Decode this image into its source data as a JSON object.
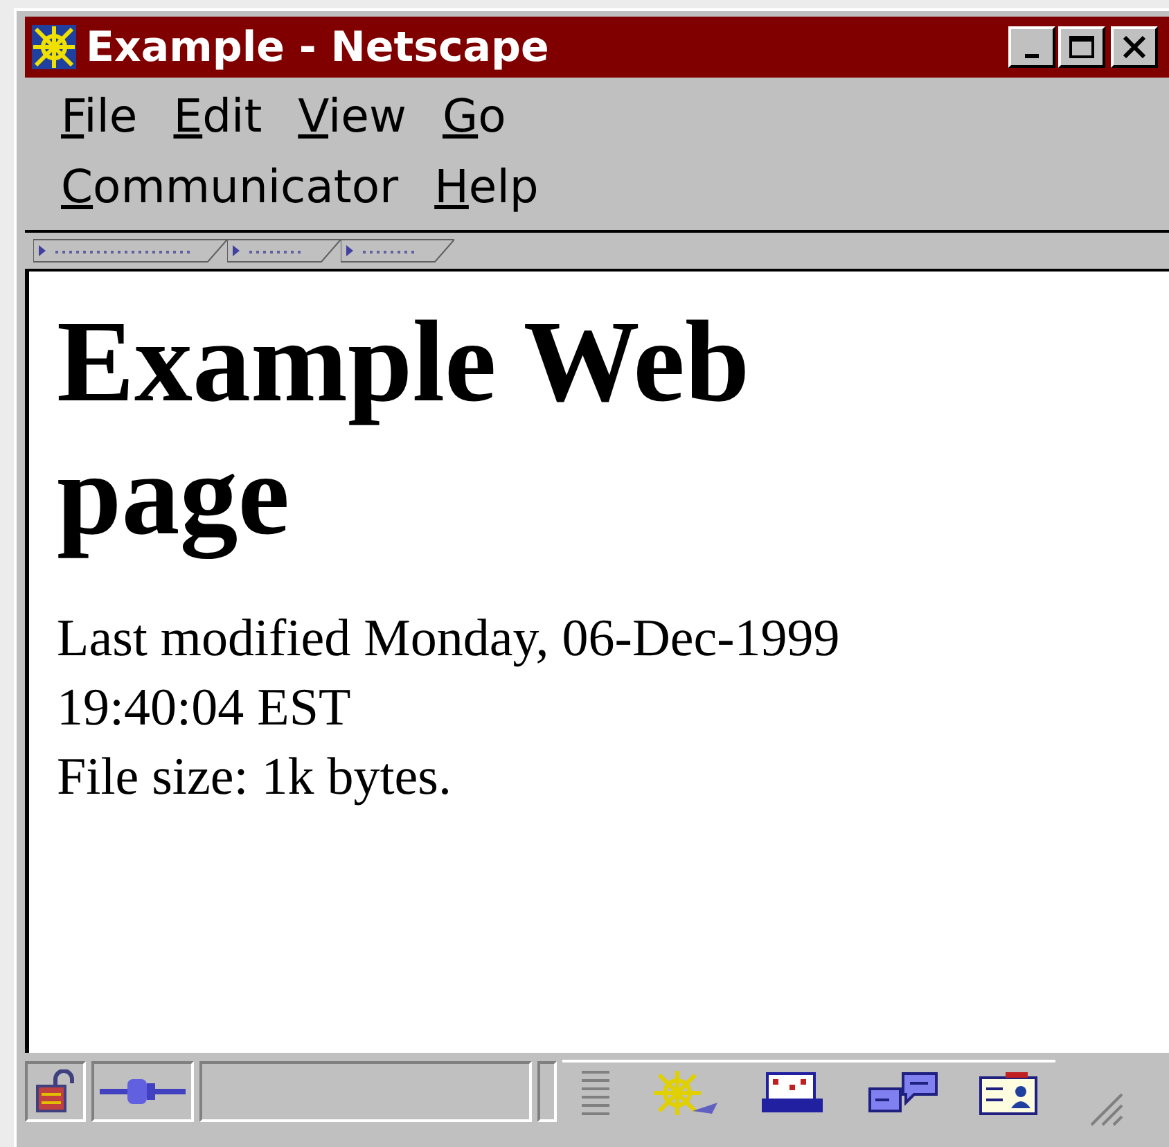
{
  "window": {
    "title": "Example - Netscape"
  },
  "menu": [
    {
      "label": "File"
    },
    {
      "label": "Edit"
    },
    {
      "label": "View"
    },
    {
      "label": "Go"
    },
    {
      "label": "Communicator"
    },
    {
      "label": "Help"
    }
  ],
  "page": {
    "heading": "Example Web page",
    "modified": "Last modified Monday, 06-Dec-1999 19:40:04 EST",
    "size": "File size: 1k bytes."
  }
}
